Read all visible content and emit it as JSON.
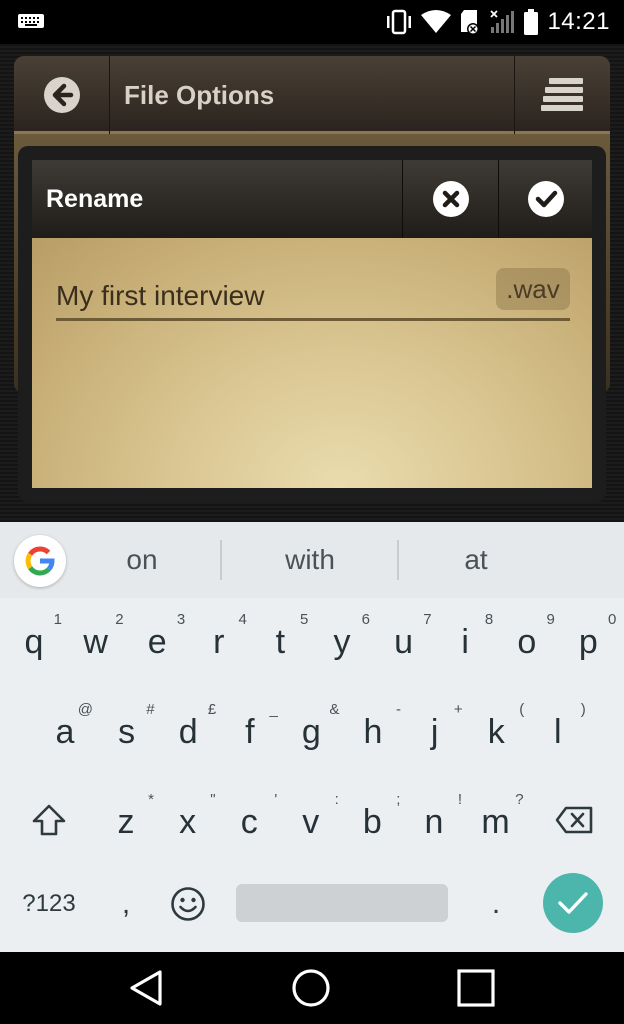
{
  "status_bar": {
    "time": "14:21",
    "icons": [
      "keyboard-icon",
      "vibrate-icon",
      "wifi-icon",
      "sd-card-icon",
      "signal-icon",
      "battery-icon"
    ]
  },
  "toolbar": {
    "title": "File Options",
    "back_icon": "arrow-left-icon",
    "menu_icon": "menu-icon"
  },
  "dialog": {
    "title": "Rename",
    "filename_value": "My first interview",
    "extension": ".wav",
    "cancel_icon": "close-icon",
    "confirm_icon": "check-icon"
  },
  "keyboard": {
    "suggestions": [
      "on",
      "with",
      "at"
    ],
    "row1": [
      {
        "k": "q",
        "h": "1"
      },
      {
        "k": "w",
        "h": "2"
      },
      {
        "k": "e",
        "h": "3"
      },
      {
        "k": "r",
        "h": "4"
      },
      {
        "k": "t",
        "h": "5"
      },
      {
        "k": "y",
        "h": "6"
      },
      {
        "k": "u",
        "h": "7"
      },
      {
        "k": "i",
        "h": "8"
      },
      {
        "k": "o",
        "h": "9"
      },
      {
        "k": "p",
        "h": "0"
      }
    ],
    "row2": [
      {
        "k": "a",
        "h": "@"
      },
      {
        "k": "s",
        "h": "#"
      },
      {
        "k": "d",
        "h": "£"
      },
      {
        "k": "f",
        "h": "_"
      },
      {
        "k": "g",
        "h": "&"
      },
      {
        "k": "h",
        "h": "-"
      },
      {
        "k": "j",
        "h": "+"
      },
      {
        "k": "k",
        "h": "("
      },
      {
        "k": "l",
        "h": ")"
      }
    ],
    "row3": [
      {
        "k": "z",
        "h": "*"
      },
      {
        "k": "x",
        "h": "\""
      },
      {
        "k": "c",
        "h": "'"
      },
      {
        "k": "v",
        "h": ":"
      },
      {
        "k": "b",
        "h": ";"
      },
      {
        "k": "n",
        "h": "!"
      },
      {
        "k": "m",
        "h": "?"
      }
    ],
    "symbols_label": "?123",
    "comma": ",",
    "period": "."
  },
  "colors": {
    "accent_enter": "#4db6ac",
    "toolbar_bg": "#3a322a",
    "parchment": "#d9c591"
  }
}
